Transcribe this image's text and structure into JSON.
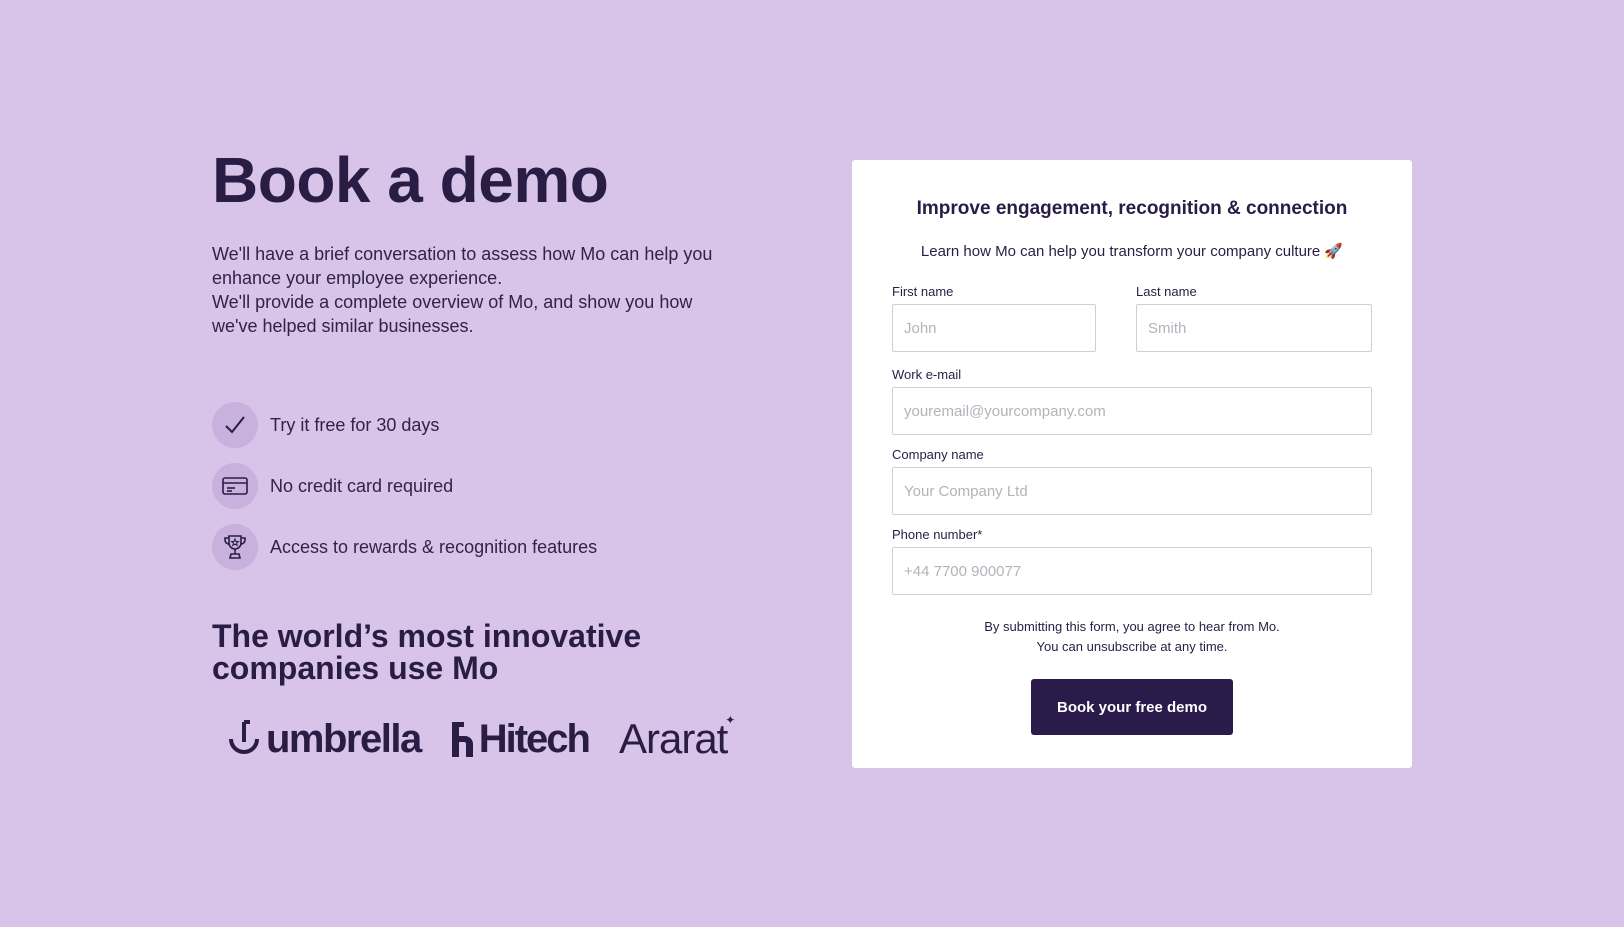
{
  "hero": {
    "title": "Book a demo",
    "intro_line1": "We'll have a brief conversation to assess how Mo can help you enhance your employee experience.",
    "intro_line2": "We'll provide a complete overview of Mo, and show you how we've helped similar businesses."
  },
  "features": [
    {
      "icon": "checkmark-icon",
      "label": "Try it free for 30 days"
    },
    {
      "icon": "credit-card-icon",
      "label": "No credit card required"
    },
    {
      "icon": "trophy-icon",
      "label": "Access to rewards & recognition features"
    }
  ],
  "logos": {
    "heading": "The world’s most innovative companies use Mo",
    "items": [
      "umbrella",
      "Hitech",
      "Ararat"
    ]
  },
  "form": {
    "title": "Improve engagement, recognition & connection",
    "subtitle": "Learn how Mo can help you transform your company culture 🚀",
    "first_name": {
      "label": "First name",
      "placeholder": "John",
      "value": ""
    },
    "last_name": {
      "label": "Last name",
      "placeholder": "Smith",
      "value": ""
    },
    "email": {
      "label": "Work e-mail",
      "placeholder": "youremail@yourcompany.com",
      "value": ""
    },
    "company": {
      "label": "Company name",
      "placeholder": "Your Company Ltd",
      "value": ""
    },
    "phone": {
      "label": "Phone number*",
      "placeholder": "+44 7700 900077",
      "value": ""
    },
    "notice_line1": "By submitting this form, you agree to hear from Mo.",
    "notice_line2": "You can unsubscribe at any time.",
    "submit_label": "Book your free demo"
  },
  "colors": {
    "background": "#d7c4e8",
    "text": "#2a1d45",
    "button": "#2a1b4b",
    "icon_circle": "#c8b1dc"
  }
}
